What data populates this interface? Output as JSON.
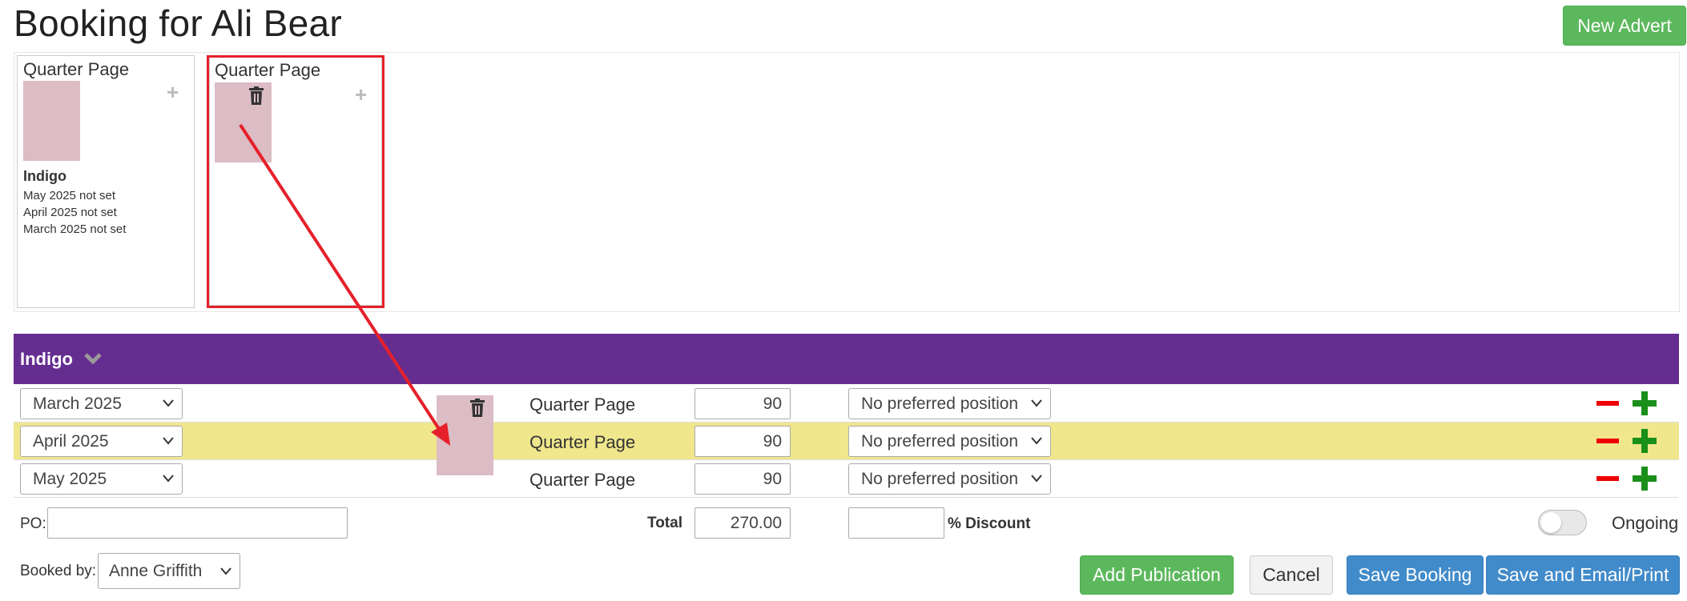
{
  "page": {
    "title": "Booking for Ali Bear"
  },
  "header": {
    "new_advert_label": "New Advert"
  },
  "ad_cards": [
    {
      "title": "Quarter Page",
      "publication": "Indigo",
      "lines": [
        "May 2025 not set",
        "April 2025 not set",
        "March 2025 not set"
      ]
    },
    {
      "title": "Quarter Page"
    }
  ],
  "publication": {
    "name": "Indigo",
    "rows": [
      {
        "month": "March 2025",
        "size": "Quarter Page",
        "price": "90",
        "position": "No preferred position"
      },
      {
        "month": "April 2025",
        "size": "Quarter Page",
        "price": "90",
        "position": "No preferred position"
      },
      {
        "month": "May 2025",
        "size": "Quarter Page",
        "price": "90",
        "position": "No preferred position"
      }
    ]
  },
  "footer": {
    "po_label": "PO:",
    "po_value": "",
    "total_label": "Total",
    "total_value": "270.00",
    "discount_value": "",
    "discount_label": "% Discount",
    "ongoing_label": "Ongoing",
    "ongoing_enabled": false,
    "booked_by_label": "Booked by:",
    "booked_by_value": "Anne Griffith"
  },
  "actions": {
    "add_publication": "Add Publication",
    "cancel": "Cancel",
    "save_booking": "Save Booking",
    "save_email_print": "Save and Email/Print"
  },
  "colors": {
    "publication_header": "#662d91",
    "highlight_row": "#f0e68c",
    "annotation": "#e5202a",
    "thumbnail": "#dcbcc5"
  }
}
